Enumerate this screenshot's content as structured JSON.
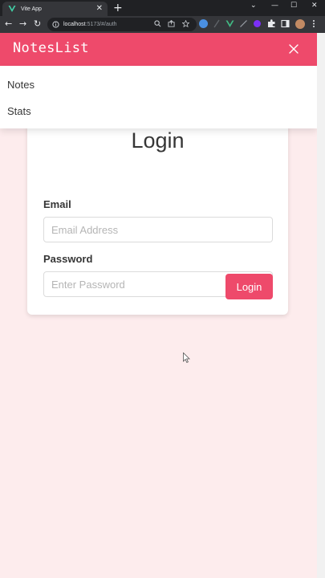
{
  "browser": {
    "tab_title": "Vite App",
    "tab_close": "✕",
    "new_tab": "+",
    "window_controls": {
      "minimize": "—",
      "maximize": "☐",
      "close": "✕",
      "dropdown": "⌄"
    },
    "url_host": "localhost",
    "url_path": ":5173/#/auth",
    "nav": {
      "back": "←",
      "forward": "→",
      "reload": "↻"
    }
  },
  "app": {
    "brand": "NotesList",
    "menu_items": [
      {
        "label": "Notes"
      },
      {
        "label": "Stats"
      }
    ],
    "accent_color": "#ee4a6b",
    "background_color": "#fdeced"
  },
  "login": {
    "title": "Login",
    "email_label": "Email",
    "email_placeholder": "Email Address",
    "email_value": "",
    "password_label": "Password",
    "password_placeholder": "Enter Password",
    "password_value": "",
    "submit_label": "Login"
  }
}
